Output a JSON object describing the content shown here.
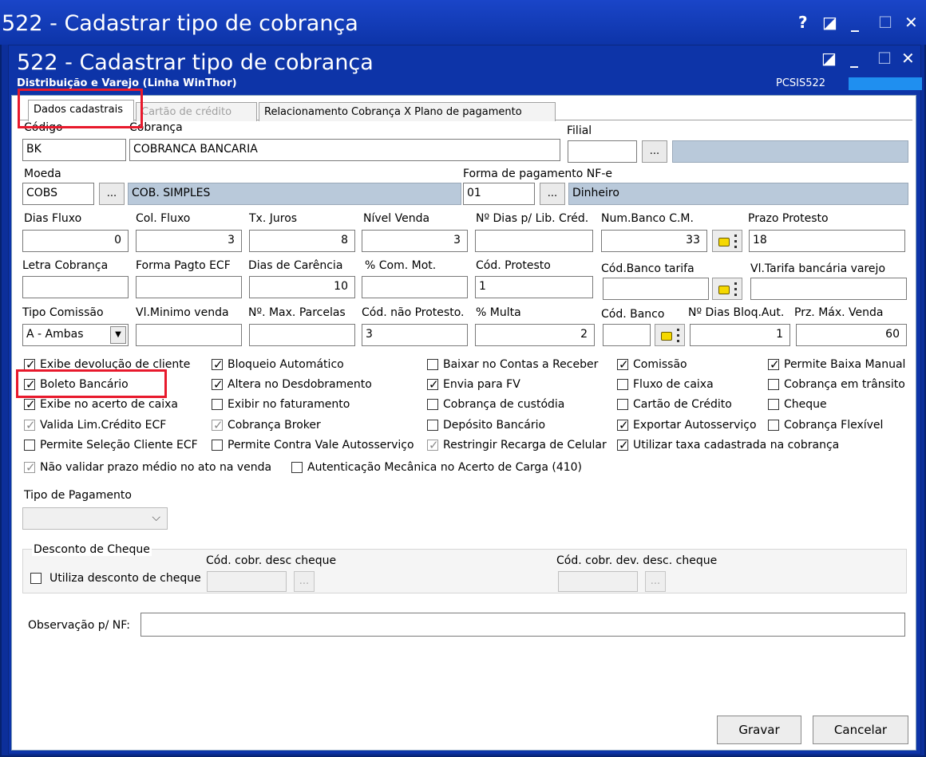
{
  "outer_window": {
    "title": "522 - Cadastrar tipo de cobrança",
    "controls": [
      "?",
      "◪",
      "_",
      "☐",
      "✕"
    ]
  },
  "inner_window": {
    "title": "522 - Cadastrar tipo de cobrança",
    "subtitle": "Distribuição e Varejo (Linha WinThor)",
    "routine_code": "PCSIS522",
    "controls": [
      "◪",
      "_",
      "☐",
      "✕"
    ]
  },
  "tabs": [
    {
      "label": "Dados cadastrais",
      "active": true
    },
    {
      "label": "Cartão de crédito",
      "disabled": true
    },
    {
      "label": "Relacionamento Cobrança X Plano de pagamento"
    }
  ],
  "fields": {
    "codigo": {
      "label": "Código",
      "value": "BK"
    },
    "cobranca": {
      "label": "Cobrança",
      "value": "COBRANCA BANCARIA"
    },
    "filial": {
      "label": "Filial",
      "value": "",
      "desc": ""
    },
    "moeda": {
      "label": "Moeda",
      "value": "COBS",
      "desc": "COB. SIMPLES"
    },
    "forma_pag_nfe": {
      "label": "Forma de pagamento NF-e",
      "value": "01",
      "desc": "Dinheiro"
    },
    "dias_fluxo": {
      "label": "Dias Fluxo",
      "value": "0"
    },
    "col_fluxo": {
      "label": "Col. Fluxo",
      "value": "3"
    },
    "tx_juros": {
      "label": "Tx. Juros",
      "value": "8"
    },
    "nivel_venda": {
      "label": "Nível Venda",
      "value": "3"
    },
    "dias_lib_cred": {
      "label": "Nº Dias p/ Lib. Créd.",
      "value": ""
    },
    "num_banco_cm": {
      "label": "Num.Banco C.M.",
      "value": "33"
    },
    "prazo_protesto": {
      "label": "Prazo Protesto",
      "value": "18"
    },
    "letra_cobranca": {
      "label": "Letra Cobrança",
      "value": ""
    },
    "forma_pagto_ecf": {
      "label": "Forma Pagto ECF",
      "value": ""
    },
    "dias_carencia": {
      "label": "Dias de Carência",
      "value": "10"
    },
    "com_mot": {
      "label": "% Com. Mot.",
      "value": ""
    },
    "cod_protesto": {
      "label": "Cód. Protesto",
      "value": "1"
    },
    "cod_banco_tarifa": {
      "label": "Cód.Banco tarifa",
      "value": ""
    },
    "vl_tarifa": {
      "label": "Vl.Tarifa bancária varejo",
      "value": ""
    },
    "tipo_comissao": {
      "label": "Tipo Comissão",
      "value": "A - Ambas"
    },
    "vl_minimo": {
      "label": "Vl.Minimo venda",
      "value": ""
    },
    "max_parcelas": {
      "label": "Nº. Max. Parcelas",
      "value": ""
    },
    "cod_nao_protesto": {
      "label": "Cód. não Protesto.",
      "value": "3"
    },
    "multa": {
      "label": "% Multa",
      "value": "2"
    },
    "cod_banco": {
      "label": "Cód. Banco",
      "value": ""
    },
    "dias_bloq": {
      "label": "Nº Dias Bloq.Aut.",
      "value": "1"
    },
    "prz_max_venda": {
      "label": "Prz. Máx. Venda",
      "value": "60"
    }
  },
  "checkboxes": [
    {
      "label": "Exibe devolução de cliente",
      "checked": true
    },
    {
      "label": "Bloqueio Automático",
      "checked": true
    },
    {
      "label": "Baixar no Contas a Receber",
      "checked": false
    },
    {
      "label": "Comissão",
      "checked": true
    },
    {
      "label": "Permite Baixa Manual",
      "checked": true
    },
    {
      "label": "Boleto Bancário",
      "checked": true
    },
    {
      "label": "Altera no Desdobramento",
      "checked": true
    },
    {
      "label": "Envia para FV",
      "checked": true
    },
    {
      "label": "Fluxo de caixa",
      "checked": false
    },
    {
      "label": "Cobrança em trânsito",
      "checked": false
    },
    {
      "label": "Exibe no acerto de caixa",
      "checked": true
    },
    {
      "label": "Exibir no faturamento",
      "checked": false
    },
    {
      "label": "Cobrança de custódia",
      "checked": false
    },
    {
      "label": "Cartão de Crédito",
      "checked": false
    },
    {
      "label": "Cheque",
      "checked": false
    },
    {
      "label": "Valida Lim.Crédito ECF",
      "checked": true,
      "disabled": true
    },
    {
      "label": "Cobrança Broker",
      "checked": true,
      "disabled": true
    },
    {
      "label": "Depósito Bancário",
      "checked": false
    },
    {
      "label": "Exportar Autosserviço",
      "checked": true
    },
    {
      "label": "Cobrança Flexível",
      "checked": false
    },
    {
      "label": "Permite Seleção Cliente ECF",
      "checked": false
    },
    {
      "label": "Permite Contra Vale Autosserviço",
      "checked": false
    },
    {
      "label": "Restringir Recarga de Celular",
      "checked": true,
      "disabled": true
    },
    {
      "label": "Utilizar taxa cadastrada na cobrança",
      "checked": true
    },
    {
      "label": "Não validar prazo médio no ato na venda",
      "checked": true,
      "disabled": true
    },
    {
      "label": "Autenticação Mecânica no Acerto de Carga (410)",
      "checked": false
    }
  ],
  "tipo_pagamento": {
    "label": "Tipo de Pagamento",
    "value": ""
  },
  "desconto_cheque": {
    "title": "Desconto de Cheque",
    "utiliza_label": "Utiliza desconto de cheque",
    "cod_cobr_label": "Cód. cobr. desc cheque",
    "cod_cobr_dev_label": "Cód. cobr. dev. desc. cheque"
  },
  "observacao": {
    "label": "Observação p/ NF:",
    "value": ""
  },
  "buttons": {
    "gravar": "Gravar",
    "cancelar": "Cancelar"
  },
  "ellipsis": "...",
  "highlight_color": "#e8192c"
}
